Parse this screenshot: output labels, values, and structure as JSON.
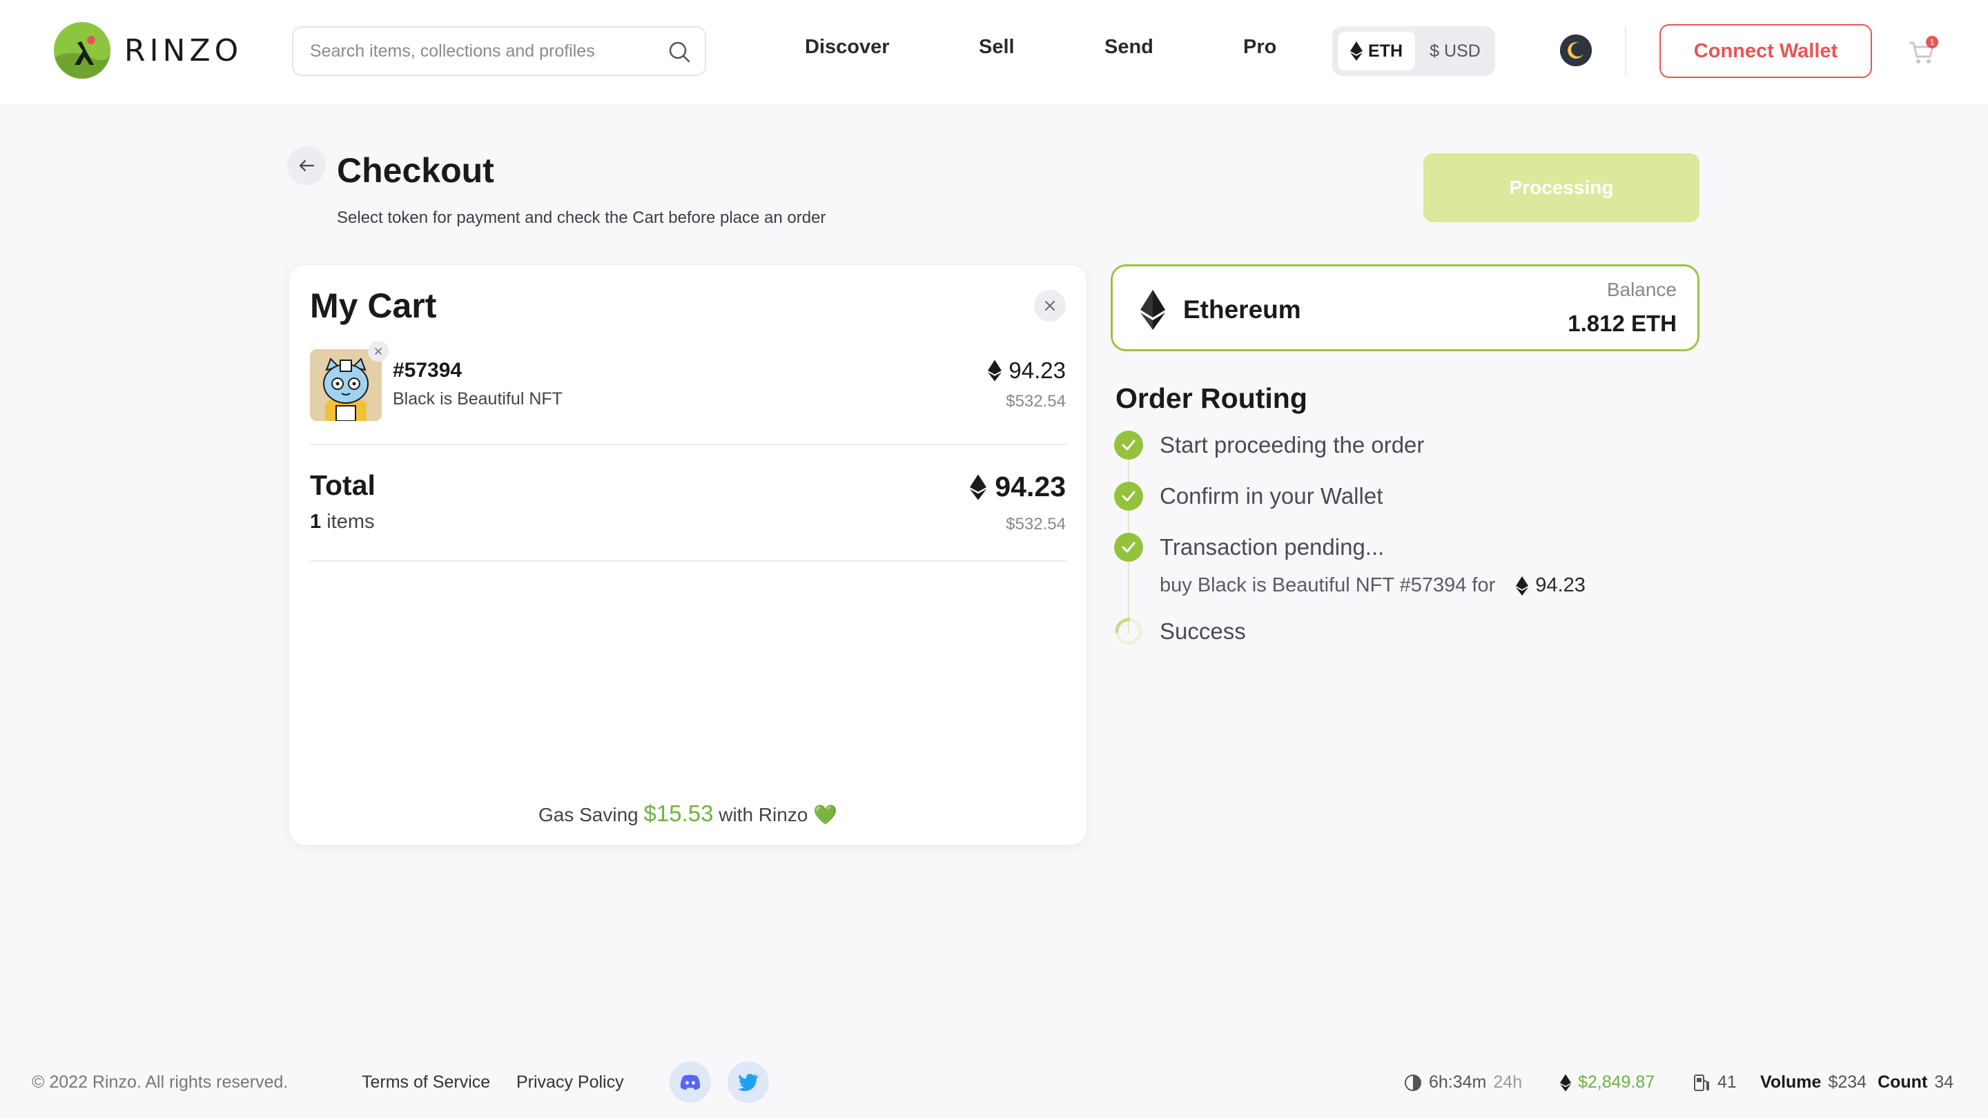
{
  "header": {
    "logo_text": "RINZO",
    "search_placeholder": "Search items, collections and profiles",
    "nav": [
      "Discover",
      "Sell",
      "Send",
      "Pro"
    ],
    "currency": {
      "eth": "ETH",
      "usd": "$ USD",
      "selected": "ETH"
    },
    "connect_wallet": "Connect Wallet",
    "cart_count": "1"
  },
  "checkout": {
    "title": "Checkout",
    "subtitle": "Select token for payment and check the Cart before place an order",
    "action_button": "Processing"
  },
  "cart": {
    "title": "My Cart",
    "items": [
      {
        "id": "#57394",
        "collection": "Black is Beautiful NFT",
        "price_eth": "94.23",
        "price_usd": "$532.54"
      }
    ],
    "total_label": "Total",
    "total_count": "1",
    "total_count_suffix": "items",
    "total_eth": "94.23",
    "total_usd": "$532.54",
    "gas_saving_prefix": "Gas Saving",
    "gas_saving_value": "$15.53",
    "gas_saving_suffix": "with Rinzo 💚"
  },
  "token": {
    "name": "Ethereum",
    "balance_label": "Balance",
    "balance_value": "1.812 ETH"
  },
  "routing": {
    "title": "Order Routing",
    "steps": [
      {
        "label": "Start proceeding the order",
        "status": "done"
      },
      {
        "label": "Confirm in your Wallet",
        "status": "done"
      },
      {
        "label": "Transaction pending...",
        "status": "done"
      },
      {
        "label": "Success",
        "status": "loading"
      }
    ],
    "detail_text": "buy Black is Beautiful NFT #57394 for",
    "detail_amount": "94.23"
  },
  "footer": {
    "copyright": "© 2022 Rinzo. All rights reserved.",
    "terms": "Terms of Service",
    "privacy": "Privacy Policy",
    "timer": "6h:34m",
    "timer_period": "24h",
    "eth_price": "$2,849.87",
    "gas": "41",
    "volume_label": "Volume",
    "volume_value": "$234",
    "count_label": "Count",
    "count_value": "34"
  },
  "colors": {
    "accent_green": "#95c23d",
    "brand_red": "#ea5455",
    "processing_bg": "#dce89b"
  }
}
